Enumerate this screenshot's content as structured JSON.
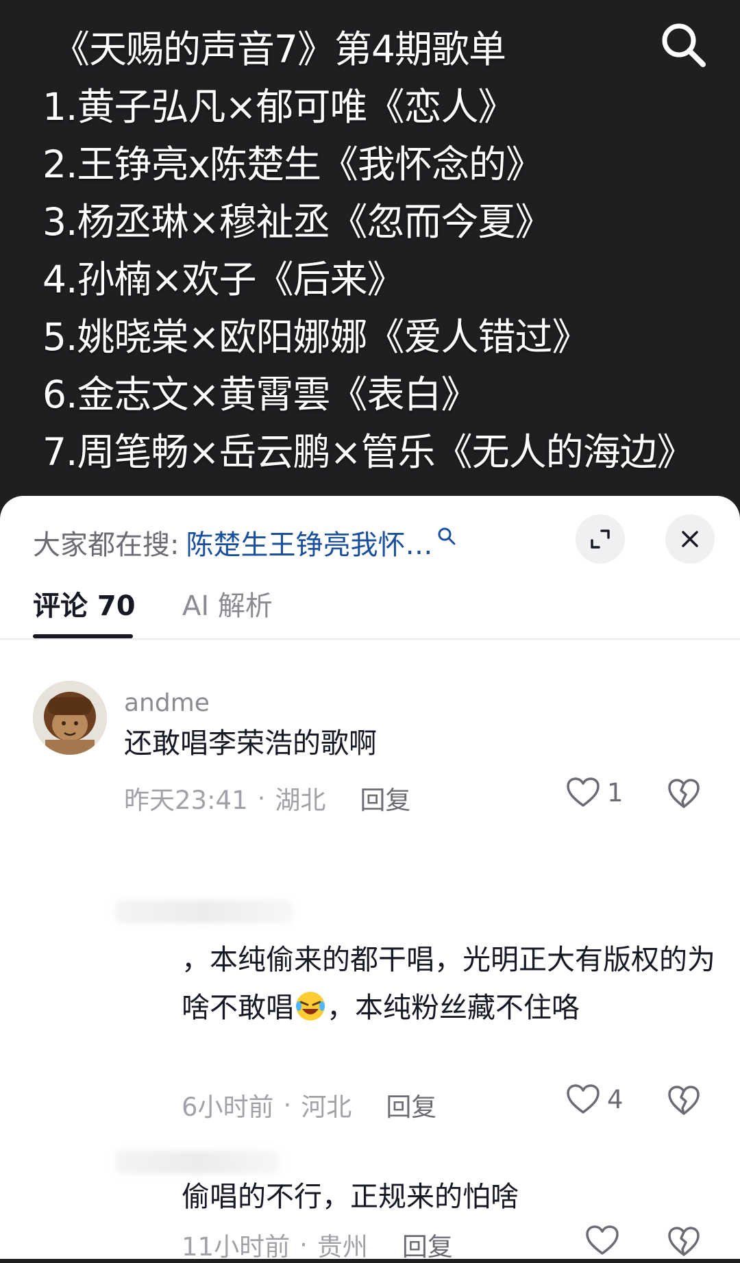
{
  "video": {
    "lines": [
      "《天赐的声音7》第4期歌单",
      "1.黄子弘凡×郁可唯《恋人》",
      "2.王铮亮x陈楚生《我怀念的》",
      "3.杨丞琳×穆祉丞《忽而今夏》",
      "4.孙楠×欢子《后来》",
      "5.姚晓棠×欧阳娜娜《爱人错过》",
      "6.金志文×黄霄雲《表白》",
      "7.周笔畅×岳云鹏×管乐《无人的海边》"
    ],
    "search_icon": "search-icon"
  },
  "sheet": {
    "hot_search_label": "大家都在搜:",
    "hot_search_query": "陈楚生王铮亮我怀…",
    "expand_icon": "expand-icon",
    "close_icon": "close-icon"
  },
  "tabs": [
    {
      "label": "评论 70",
      "active": true
    },
    {
      "label": "AI 解析",
      "active": false
    }
  ],
  "comments": [
    {
      "username": "andme",
      "text": "还敢唱李荣浩的歌啊",
      "time": "昨天23:41",
      "location": "湖北",
      "reply_label": "回复",
      "likes": "1"
    },
    {
      "username": "",
      "text_part1": "，本纯偷来的都干唱，光明正大有版权的为啥不敢唱",
      "text_part2": "，",
      "text_part3": "本纯粉丝藏不住咯",
      "time": "6小时前",
      "location": "河北",
      "reply_label": "回复",
      "likes": "4"
    },
    {
      "username": "",
      "text": "偷唱的不行，正规来的怕啥",
      "time": "11小时前",
      "location": "贵州",
      "reply_label": "回复",
      "likes": ""
    }
  ],
  "colors": {
    "video_bg": "#1f1f22",
    "sheet_bg": "#ffffff",
    "link": "#1a4f9c",
    "muted": "#a1a2a7"
  }
}
